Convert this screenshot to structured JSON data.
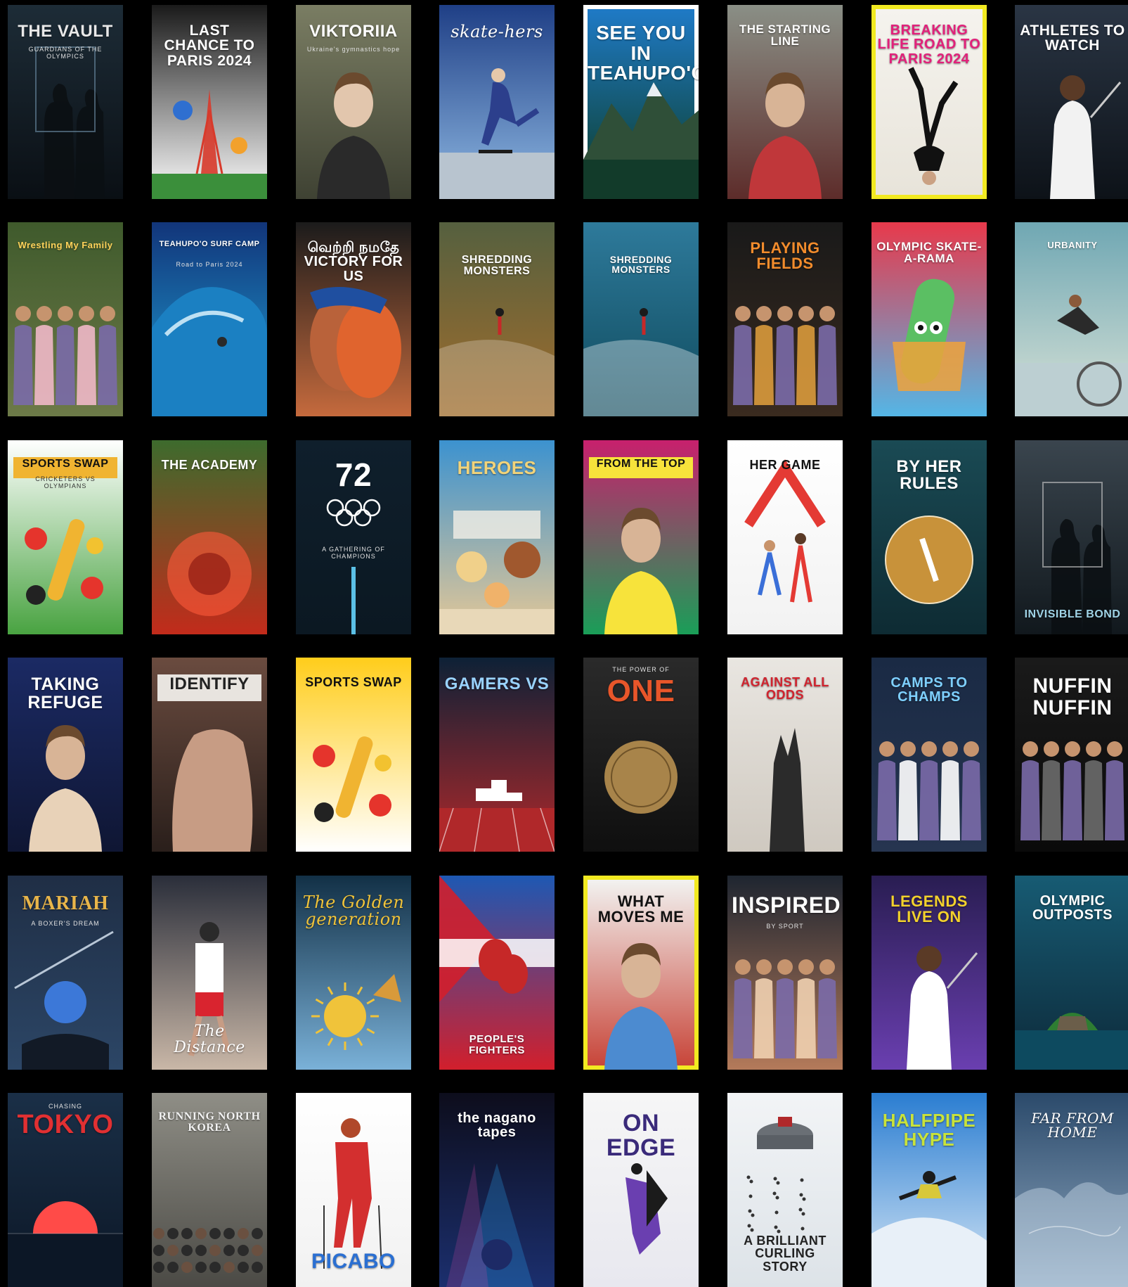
{
  "posters": [
    {
      "title": "THE VAULT",
      "subtitle": "GUARDIANS OF THE OLYMPICS",
      "bg": "#1d2c37",
      "bg2": "#0a0f14",
      "color": "#e8e8e8",
      "ty": "top",
      "size": 24,
      "figure": "silhouette",
      "accent": "#6e8fa8"
    },
    {
      "title": "LAST CHANCE TO PARIS 2024",
      "subtitle": "",
      "bg": "#1a1a1a",
      "bg2": "#ffffff",
      "color": "#ffffff",
      "ty": "top",
      "size": 21,
      "figure": "tower",
      "accent": "#d83a2b"
    },
    {
      "title": "VIKTORIIA",
      "subtitle": "Ukraine's gymnastics hope",
      "bg": "#7a7d63",
      "bg2": "#3f4233",
      "color": "#ffffff",
      "ty": "top",
      "size": 24,
      "figure": "person",
      "accent": "#2a2a2a"
    },
    {
      "title": "skate-hers",
      "subtitle": "",
      "bg": "#1f3f86",
      "bg2": "#8fb9e3",
      "color": "#ffffff",
      "ty": "top",
      "size": 24,
      "figure": "skater",
      "accent": "#ffffff",
      "script": true
    },
    {
      "title": "SEE YOU IN TEAHUPO'O",
      "subtitle": "",
      "bg": "#1f7ac6",
      "bg2": "#0c3b24",
      "color": "#ffffff",
      "ty": "top",
      "size": 28,
      "figure": "mountain",
      "accent": "#e9eef3",
      "frame": "#ffffff"
    },
    {
      "title": "THE STARTING LINE",
      "subtitle": "",
      "bg": "#8a8f86",
      "bg2": "#5d2c2a",
      "color": "#ffffff",
      "ty": "top",
      "size": 17,
      "figure": "person",
      "accent": "#c0373a"
    },
    {
      "title": "BREAKING LIFE ROAD TO PARIS 2024",
      "subtitle": "",
      "bg": "#f5f3ee",
      "bg2": "#e8e4da",
      "color": "#e2207a",
      "ty": "top",
      "size": 20,
      "figure": "breaker",
      "accent": "#111111",
      "frame": "#f2ea21"
    },
    {
      "title": "ATHLETES TO WATCH",
      "subtitle": "",
      "bg": "#2a3544",
      "bg2": "#0d1218",
      "color": "#ffffff",
      "ty": "top",
      "size": 21,
      "figure": "fencer",
      "accent": "#f2f2f2"
    },
    {
      "title": "Wrestling My Family",
      "subtitle": "",
      "bg": "#3f5a2c",
      "bg2": "#6d7a48",
      "color": "#ffd35a",
      "ty": "top",
      "size": 13,
      "figure": "group",
      "accent": "#f0b8c8"
    },
    {
      "title": "TEAHUPO'O SURF CAMP",
      "subtitle": "Road to Paris 2024",
      "bg": "#12357a",
      "bg2": "#1fa3d6",
      "color": "#ffffff",
      "ty": "top",
      "size": 11,
      "figure": "wave",
      "accent": "#e6f7ff"
    },
    {
      "title": "வெற்றி நமதே VICTORY FOR US",
      "subtitle": "",
      "bg": "#1b1b1b",
      "bg2": "#c56a3d",
      "color": "#ffffff",
      "ty": "top",
      "size": 20,
      "figure": "hug",
      "accent": "#e0642e"
    },
    {
      "title": "SHREDDING MONSTERS",
      "subtitle": "",
      "bg": "#55603f",
      "bg2": "#a26d2c",
      "color": "#ffffff",
      "ty": "mid",
      "size": 16,
      "figure": "surfer",
      "accent": "#dcd2bf"
    },
    {
      "title": "SHREDDING MONSTERS",
      "subtitle": "",
      "bg": "#2e7a9b",
      "bg2": "#0f4a5c",
      "color": "#ffffff",
      "ty": "mid",
      "size": 14,
      "figure": "surfer",
      "accent": "#ffffff"
    },
    {
      "title": "PLAYING FIELDS",
      "subtitle": "",
      "bg": "#191919",
      "bg2": "#3a2b1f",
      "color": "#f28c2c",
      "ty": "top",
      "size": 22,
      "figure": "group",
      "accent": "#d99a3c"
    },
    {
      "title": "OLYMPIC SKATE-A-RAMA",
      "subtitle": "",
      "bg": "#e8394b",
      "bg2": "#54b6e6",
      "color": "#ffffff",
      "ty": "top",
      "size": 17,
      "figure": "board",
      "accent": "#5bbf63"
    },
    {
      "title": "URBANITY",
      "subtitle": "",
      "bg": "#6fa7b3",
      "bg2": "#d8e2d7",
      "color": "#ffffff",
      "ty": "top",
      "size": 13,
      "figure": "jump",
      "accent": "#2a2a2a"
    },
    {
      "title": "SPORTS SWAP",
      "subtitle": "CRICKETERS VS OLYMPIANS",
      "bg": "#ffffff",
      "bg2": "#49a341",
      "color": "#111111",
      "ty": "top",
      "size": 16,
      "figure": "balls",
      "accent": "#e5342c",
      "bar": "#f0b431"
    },
    {
      "title": "THE ACADEMY",
      "subtitle": "",
      "bg": "#3d6b2d",
      "bg2": "#c22b1b",
      "color": "#ffffff",
      "ty": "top",
      "size": 18,
      "figure": "circle",
      "accent": "#ff5a3a"
    },
    {
      "title": "72",
      "subtitle": "A GATHERING OF CHAMPIONS",
      "bg": "#0f1f2c",
      "bg2": "#0b1822",
      "color": "#ffffff",
      "ty": "top",
      "size": 46,
      "figure": "rings",
      "accent": "#5bc0e6"
    },
    {
      "title": "HEROES",
      "subtitle": "",
      "bg": "#3c92cf",
      "bg2": "#e6c896",
      "color": "#f1d37a",
      "ty": "top",
      "size": 26,
      "figure": "cartoon",
      "accent": "#f0b26a"
    },
    {
      "title": "FROM THE TOP",
      "subtitle": "",
      "bg": "#c8206d",
      "bg2": "#1a9e58",
      "color": "#111111",
      "ty": "top",
      "size": 16,
      "figure": "person",
      "accent": "#f7e33b",
      "bar": "#f7e33b"
    },
    {
      "title": "HER GAME",
      "subtitle": "",
      "bg": "#ffffff",
      "bg2": "#f2f2f2",
      "color": "#111111",
      "ty": "top",
      "size": 18,
      "figure": "athletes",
      "accent": "#e43a34"
    },
    {
      "title": "BY HER RULES",
      "subtitle": "",
      "bg": "#1a4a54",
      "bg2": "#0e2b33",
      "color": "#ffffff",
      "ty": "top",
      "size": 24,
      "figure": "court",
      "accent": "#c8923a"
    },
    {
      "title": "INVISIBLE BOND",
      "subtitle": "",
      "bg": "#3a454e",
      "bg2": "#11181d",
      "color": "#9fd3e6",
      "ty": "bottom",
      "size": 16,
      "figure": "silhouette",
      "accent": "#c9c9c9"
    },
    {
      "title": "TAKING REFUGE",
      "subtitle": "",
      "bg": "#1b2a64",
      "bg2": "#0f1633",
      "color": "#ffffff",
      "ty": "top",
      "size": 25,
      "figure": "person",
      "accent": "#e8d2b8"
    },
    {
      "title": "IDENTIFY",
      "subtitle": "",
      "bg": "#6a4b3f",
      "bg2": "#2a1f1b",
      "color": "#222222",
      "ty": "top",
      "size": 24,
      "figure": "torso",
      "accent": "#c79c84",
      "bar": "#e8e4df"
    },
    {
      "title": "SPORTS SWAP",
      "subtitle": "",
      "bg": "#ffcd1b",
      "bg2": "#ffffff",
      "color": "#111111",
      "ty": "top",
      "size": 18,
      "figure": "balls",
      "accent": "#e5342c"
    },
    {
      "title": "GAMERS VS",
      "subtitle": "",
      "bg": "#0d2136",
      "bg2": "#b0282a",
      "color": "#9ad3ff",
      "ty": "top",
      "size": 24,
      "figure": "podium",
      "accent": "#ffffff"
    },
    {
      "title": "ONE",
      "subtitle": "THE POWER OF",
      "bg": "#2a2a2a",
      "bg2": "#0f0f0f",
      "color": "#e8562a",
      "ty": "top",
      "size": 44,
      "figure": "medal",
      "accent": "#a8844a"
    },
    {
      "title": "AGAINST ALL ODDS",
      "subtitle": "",
      "bg": "#e9e6e1",
      "bg2": "#cfc9c0",
      "color": "#d0232e",
      "ty": "top",
      "size": 18,
      "figure": "hands",
      "accent": "#2b2b2b"
    },
    {
      "title": "CAMPS TO CHAMPS",
      "subtitle": "",
      "bg": "#1a2a44",
      "bg2": "#263550",
      "color": "#7ed0ff",
      "ty": "top",
      "size": 20,
      "figure": "group",
      "accent": "#ffffff"
    },
    {
      "title": "NUFFIN NUFFIN",
      "subtitle": "",
      "bg": "#1a1a1a",
      "bg2": "#0a0a0a",
      "color": "#ffffff",
      "ty": "top",
      "size": 30,
      "figure": "group",
      "accent": "#6b6b6b"
    },
    {
      "title": "MARIAH",
      "subtitle": "A BOXER'S DREAM",
      "bg": "#1f2e45",
      "bg2": "#2c4666",
      "color": "#e8b54a",
      "ty": "top",
      "size": 28,
      "figure": "boxer",
      "accent": "#3c78d8",
      "serif": true
    },
    {
      "title": "The Distance",
      "subtitle": "",
      "bg": "#2a2e3a",
      "bg2": "#c9b7a7",
      "color": "#ffffff",
      "ty": "bottom",
      "size": 22,
      "figure": "runner",
      "accent": "#d9242f",
      "script": true
    },
    {
      "title": "The Golden generation",
      "subtitle": "",
      "bg": "#123046",
      "bg2": "#7ab1d8",
      "color": "#f0c33a",
      "ty": "top",
      "size": 24,
      "figure": "sun",
      "accent": "#f0c33a",
      "script": true
    },
    {
      "title": "PEOPLE'S FIGHTERS",
      "subtitle": "",
      "bg": "#1e58b3",
      "bg2": "#d21f2c",
      "color": "#ffffff",
      "ty": "bottom",
      "size": 15,
      "figure": "gloves",
      "accent": "#c62828"
    },
    {
      "title": "WHAT MOVES ME",
      "subtitle": "",
      "bg": "#f2f2f0",
      "bg2": "#c8463a",
      "color": "#111111",
      "ty": "top",
      "size": 22,
      "figure": "person",
      "accent": "#4c8bd0",
      "frame": "#f2ea21"
    },
    {
      "title": "INSPIRED",
      "subtitle": "BY SPORT",
      "bg": "#1e2530",
      "bg2": "#b47a5a",
      "color": "#ffffff",
      "ty": "top",
      "size": 32,
      "figure": "group",
      "accent": "#f0d0b0"
    },
    {
      "title": "LEGENDS LIVE ON",
      "subtitle": "",
      "bg": "#291d52",
      "bg2": "#6a3fb0",
      "color": "#f2d12c",
      "ty": "top",
      "size": 22,
      "figure": "fencer",
      "accent": "#ffffff"
    },
    {
      "title": "OLYMPIC OUTPOSTS",
      "subtitle": "",
      "bg": "#175b73",
      "bg2": "#0d2a3a",
      "color": "#ffffff",
      "ty": "top",
      "size": 20,
      "figure": "island",
      "accent": "#2e7d32"
    },
    {
      "title": "TOKYO",
      "subtitle": "CHASING",
      "bg": "#1a2f47",
      "bg2": "#0c1726",
      "color": "#e13032",
      "ty": "top",
      "size": 38,
      "figure": "sunset",
      "accent": "#ff4b48"
    },
    {
      "title": "RUNNING NORTH KOREA",
      "subtitle": "",
      "bg": "#8f8e86",
      "bg2": "#4b4a45",
      "color": "#f2f2f2",
      "ty": "top",
      "size": 16,
      "figure": "crowd",
      "accent": "#5d5d5d",
      "serif": true
    },
    {
      "title": "PICABO",
      "subtitle": "",
      "bg": "#ffffff",
      "bg2": "#f1f1f1",
      "color": "#2a6fd2",
      "ty": "bottom",
      "size": 30,
      "figure": "skier",
      "accent": "#d32f2f"
    },
    {
      "title": "the nagano tapes",
      "subtitle": "",
      "bg": "#0d0d1c",
      "bg2": "#1b2f6e",
      "color": "#ffffff",
      "ty": "top",
      "size": 20,
      "figure": "spotlight",
      "accent": "#2bb0ff"
    },
    {
      "title": "ON EDGE",
      "subtitle": "",
      "bg": "#f6f6f6",
      "bg2": "#e8e8ef",
      "color": "#3a2a7a",
      "ty": "top",
      "size": 34,
      "figure": "skaters",
      "accent": "#6a3fb0"
    },
    {
      "title": "A BRILLIANT CURLING STORY",
      "subtitle": "",
      "bg": "#f2f4f6",
      "bg2": "#dde3e8",
      "color": "#222222",
      "ty": "bottom",
      "size": 18,
      "figure": "stone",
      "accent": "#333333"
    },
    {
      "title": "HALFPIPE HYPE",
      "subtitle": "",
      "bg": "#2a7dd1",
      "bg2": "#d8e8f6",
      "color": "#c9e33a",
      "ty": "top",
      "size": 26,
      "figure": "boarder",
      "accent": "#1b1b1b"
    },
    {
      "title": "FAR FROM HOME",
      "subtitle": "",
      "bg": "#2b4a6b",
      "bg2": "#8fa8c0",
      "color": "#ffffff",
      "ty": "top",
      "size": 20,
      "figure": "globe",
      "accent": "#d8e6f2",
      "script": true
    }
  ]
}
